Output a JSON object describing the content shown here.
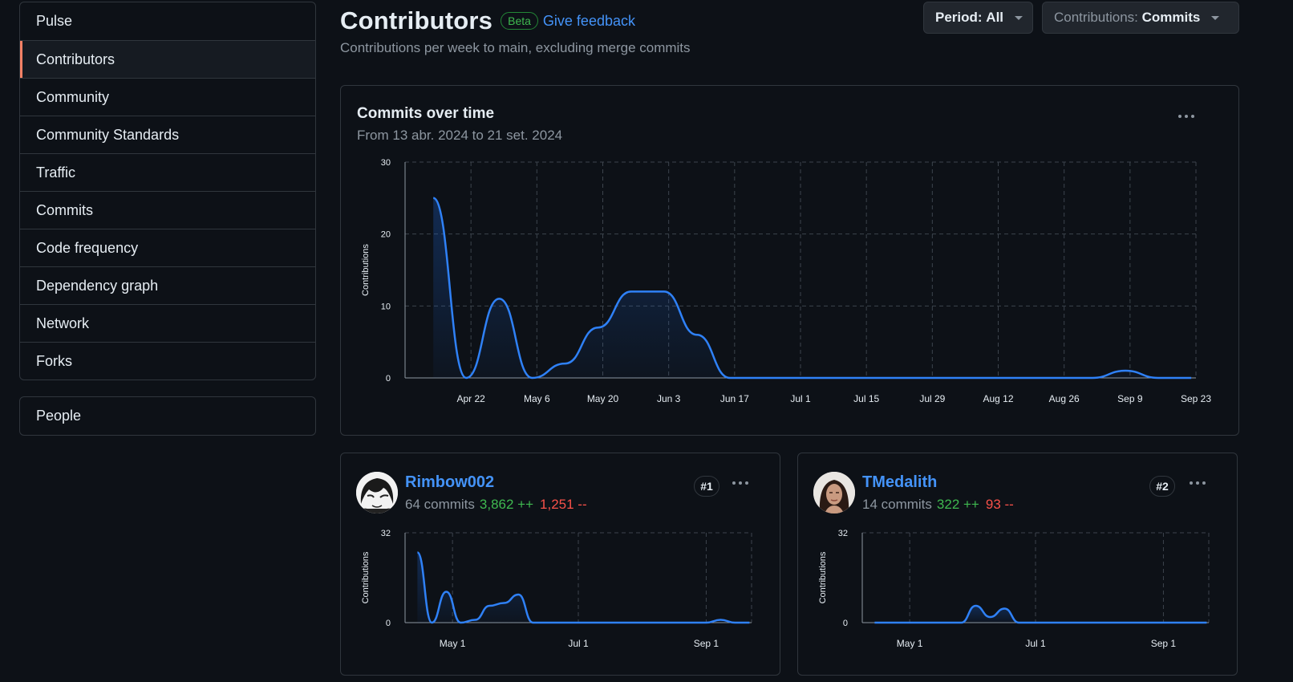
{
  "sidebar": {
    "items": [
      {
        "label": "Pulse"
      },
      {
        "label": "Contributors"
      },
      {
        "label": "Community"
      },
      {
        "label": "Community Standards"
      },
      {
        "label": "Traffic"
      },
      {
        "label": "Commits"
      },
      {
        "label": "Code frequency"
      },
      {
        "label": "Dependency graph"
      },
      {
        "label": "Network"
      },
      {
        "label": "Forks"
      }
    ],
    "people": "People"
  },
  "header": {
    "title": "Contributors",
    "beta": "Beta",
    "feedback": "Give feedback",
    "subtitle": "Contributions per week to main, excluding merge commits",
    "period_prefix": "Period: ",
    "period_value": "All",
    "contrib_prefix": "Contributions: ",
    "contrib_value": "Commits"
  },
  "colors": {
    "accent": "#1f6feb",
    "line": "#2f81f7",
    "added": "#3fb950",
    "deleted": "#f85149",
    "selected_bar": "#f78166"
  },
  "main_chart": {
    "title": "Commits over time",
    "subtitle": "From 13 abr. 2024 to 21 set. 2024"
  },
  "contributors": [
    {
      "name": "Rimbow002",
      "commits": "64 commits",
      "additions": "3,862 ++",
      "deletions": "1,251 --",
      "rank": "#1"
    },
    {
      "name": "TMedalith",
      "commits": "14 commits",
      "additions": "322 ++",
      "deletions": "93 --",
      "rank": "#2"
    }
  ],
  "chart_data": [
    {
      "type": "area",
      "title": "Commits over time",
      "ylabel": "Contributions",
      "ylim": [
        0,
        30
      ],
      "yticks": [
        0,
        10,
        20,
        30
      ],
      "x_ticks": [
        "Apr 22",
        "May 6",
        "May 20",
        "Jun 3",
        "Jun 17",
        "Jul 1",
        "Jul 15",
        "Jul 29",
        "Aug 12",
        "Aug 26",
        "Sep 9",
        "Sep 23"
      ],
      "x": [
        "2024-04-14",
        "2024-04-21",
        "2024-04-28",
        "2024-05-05",
        "2024-05-12",
        "2024-05-19",
        "2024-05-26",
        "2024-06-02",
        "2024-06-09",
        "2024-06-16",
        "2024-06-23",
        "2024-06-30",
        "2024-07-07",
        "2024-07-14",
        "2024-07-21",
        "2024-07-28",
        "2024-08-04",
        "2024-08-11",
        "2024-08-18",
        "2024-08-25",
        "2024-09-01",
        "2024-09-08",
        "2024-09-15",
        "2024-09-22"
      ],
      "values": [
        25,
        0,
        11,
        0,
        2,
        7,
        12,
        12,
        6,
        0,
        0,
        0,
        0,
        0,
        0,
        0,
        0,
        0,
        0,
        0,
        0,
        1,
        0,
        0
      ],
      "grid": true
    },
    {
      "type": "area",
      "title": "Rimbow002",
      "ylabel": "Contributions",
      "ylim": [
        0,
        32
      ],
      "yticks": [
        0,
        32
      ],
      "x_ticks": [
        "May 1",
        "Jul 1",
        "Sep 1"
      ],
      "x": [
        "2024-04-14",
        "2024-04-21",
        "2024-04-28",
        "2024-05-05",
        "2024-05-12",
        "2024-05-19",
        "2024-05-26",
        "2024-06-02",
        "2024-06-09",
        "2024-06-16",
        "2024-06-23",
        "2024-06-30",
        "2024-07-07",
        "2024-07-14",
        "2024-07-21",
        "2024-07-28",
        "2024-08-04",
        "2024-08-11",
        "2024-08-18",
        "2024-08-25",
        "2024-09-01",
        "2024-09-08",
        "2024-09-15",
        "2024-09-22"
      ],
      "values": [
        25,
        0,
        11,
        0,
        1,
        6,
        7,
        10,
        0,
        0,
        0,
        0,
        0,
        0,
        0,
        0,
        0,
        0,
        0,
        0,
        0,
        1,
        0,
        0
      ],
      "grid": true
    },
    {
      "type": "area",
      "title": "TMedalith",
      "ylabel": "Contributions",
      "ylim": [
        0,
        32
      ],
      "yticks": [
        0,
        32
      ],
      "x_ticks": [
        "May 1",
        "Jul 1",
        "Sep 1"
      ],
      "x": [
        "2024-04-14",
        "2024-04-21",
        "2024-04-28",
        "2024-05-05",
        "2024-05-12",
        "2024-05-19",
        "2024-05-26",
        "2024-06-02",
        "2024-06-09",
        "2024-06-16",
        "2024-06-23",
        "2024-06-30",
        "2024-07-07",
        "2024-07-14",
        "2024-07-21",
        "2024-07-28",
        "2024-08-04",
        "2024-08-11",
        "2024-08-18",
        "2024-08-25",
        "2024-09-01",
        "2024-09-08",
        "2024-09-15",
        "2024-09-22"
      ],
      "values": [
        0,
        0,
        0,
        0,
        0,
        0,
        0,
        6,
        2,
        5,
        0,
        0,
        0,
        0,
        0,
        0,
        0,
        0,
        0,
        0,
        0,
        0,
        0,
        0
      ],
      "grid": true
    }
  ]
}
